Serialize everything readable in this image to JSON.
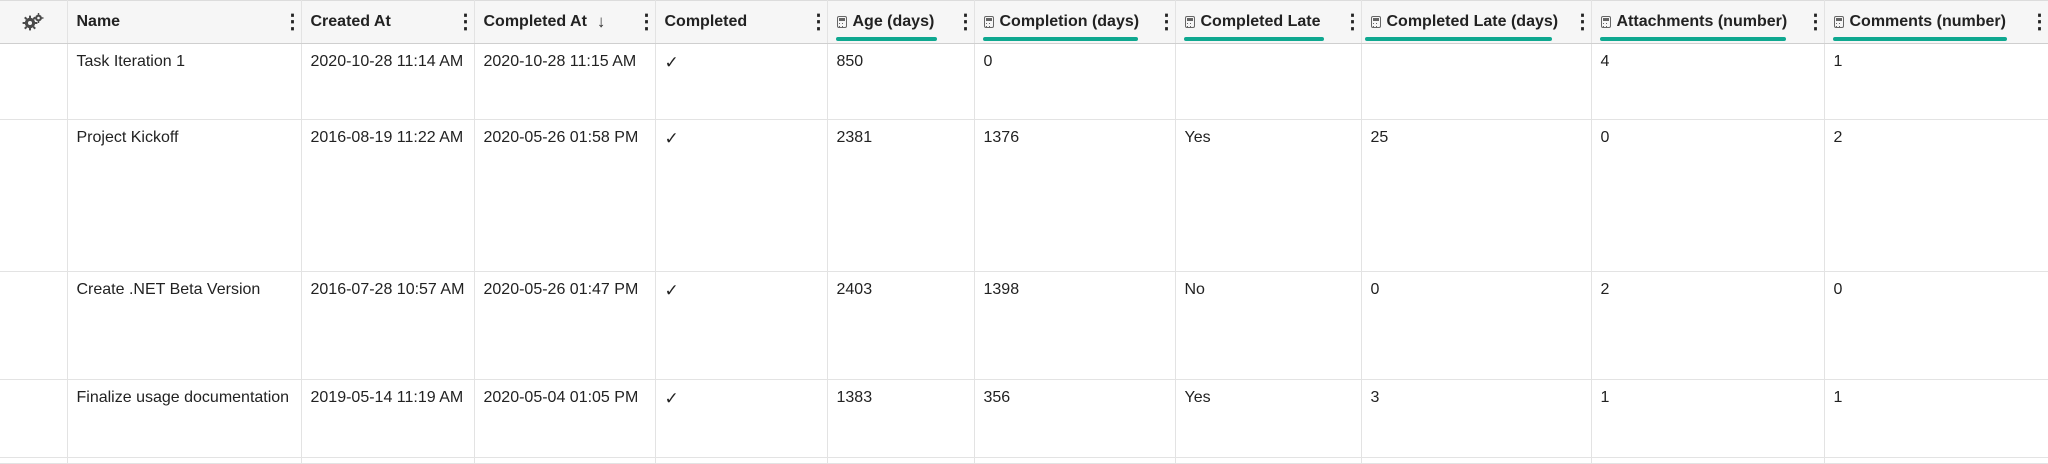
{
  "table": {
    "columns": [
      {
        "key": "settings",
        "label": "",
        "icon": "gear-icon"
      },
      {
        "key": "name",
        "label": "Name"
      },
      {
        "key": "created_at",
        "label": "Created At"
      },
      {
        "key": "completed_at",
        "label": "Completed At",
        "sorted": "descending",
        "sort_icon": "↓"
      },
      {
        "key": "completed",
        "label": "Completed"
      },
      {
        "key": "age_days",
        "label": "Age (days)",
        "calculated": true,
        "highlighted": true
      },
      {
        "key": "completion_days",
        "label": "Completion (days)",
        "calculated": true,
        "highlighted": true
      },
      {
        "key": "completed_late",
        "label": "Completed Late",
        "calculated": true,
        "highlighted": true
      },
      {
        "key": "completed_late_days",
        "label": "Completed Late (days)",
        "calculated": true,
        "highlighted": true
      },
      {
        "key": "attachments_number",
        "label": "Attachments (number)",
        "calculated": true,
        "highlighted": true
      },
      {
        "key": "comments_number",
        "label": "Comments (number)",
        "calculated": true,
        "highlighted": true
      }
    ],
    "menu_glyph": "⋮",
    "check_glyph": "✓",
    "highlight_color": "#0fa890",
    "rows": [
      {
        "name": "Task Iteration 1",
        "created_at": "2020-10-28 11:14 AM",
        "completed_at": "2020-10-28 11:15 AM",
        "completed": "✓",
        "age_days": "850",
        "completion_days": "0",
        "completed_late": "",
        "completed_late_days": "",
        "attachments_number": "4",
        "comments_number": "1"
      },
      {
        "name": "Project Kickoff",
        "created_at": "2016-08-19 11:22 AM",
        "completed_at": "2020-05-26 01:58 PM",
        "completed": "✓",
        "age_days": "2381",
        "completion_days": "1376",
        "completed_late": "Yes",
        "completed_late_days": "25",
        "attachments_number": "0",
        "comments_number": "2"
      },
      {
        "name": "Create .NET Beta Version",
        "created_at": "2016-07-28 10:57 AM",
        "completed_at": "2020-05-26 01:47 PM",
        "completed": "✓",
        "age_days": "2403",
        "completion_days": "1398",
        "completed_late": "No",
        "completed_late_days": "0",
        "attachments_number": "2",
        "comments_number": "0"
      },
      {
        "name": "Finalize usage documentation",
        "created_at": "2019-05-14 11:19 AM",
        "completed_at": "2020-05-04 01:05 PM",
        "completed": "✓",
        "age_days": "1383",
        "completion_days": "356",
        "completed_late": "Yes",
        "completed_late_days": "3",
        "attachments_number": "1",
        "comments_number": "1"
      }
    ]
  }
}
